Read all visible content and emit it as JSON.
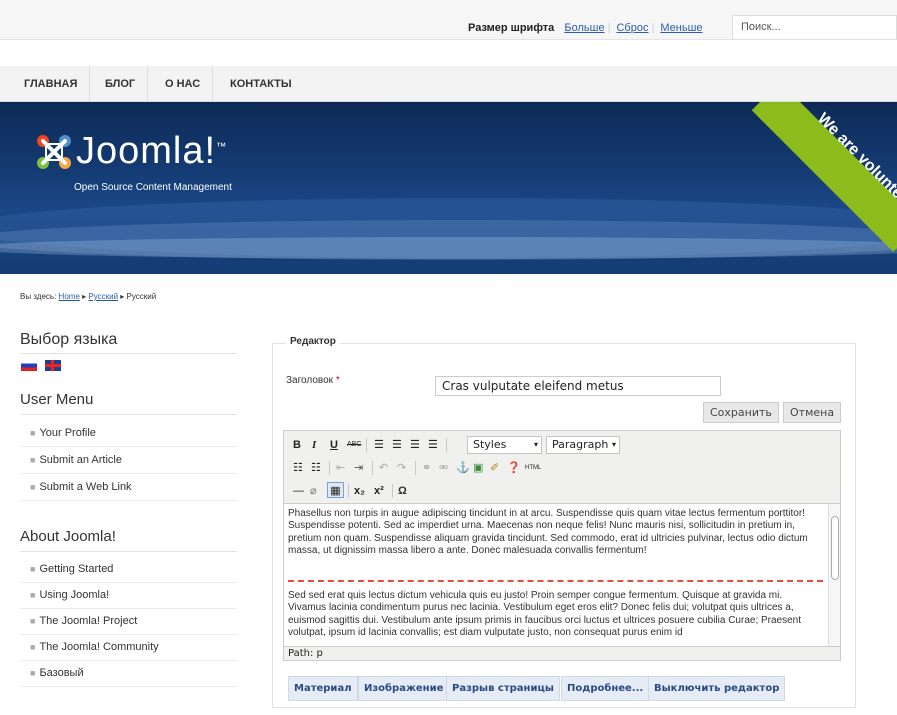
{
  "topbar": {
    "font_size_label": "Размер шрифта",
    "bigger": "Больше",
    "reset": "Сброс",
    "smaller": "Меньше",
    "search_placeholder": "Поиск..."
  },
  "nav": {
    "items": [
      {
        "label": "ГЛАВНАЯ"
      },
      {
        "label": "БЛОГ"
      },
      {
        "label": "О НАС"
      },
      {
        "label": "КОНТАКТЫ"
      }
    ]
  },
  "header": {
    "logo_text": "Joomla!",
    "logo_tm": "™",
    "logo_sub": "Open Source Content Management",
    "ribbon": "We are volunteers!",
    "colors": {
      "accent_ribbon": "#8cbc1c",
      "header_blue": "#13396f"
    }
  },
  "breadcrumb": {
    "prefix": "Вы здесь:",
    "items": [
      "Home",
      "Русский",
      "Русский"
    ]
  },
  "sidebar": {
    "lang_title": "Выбор языка",
    "user_menu_title": "User Menu",
    "user_menu": [
      "Your Profile",
      "Submit an Article",
      "Submit a Web Link"
    ],
    "about_title": "About Joomla!",
    "about": [
      "Getting Started",
      "Using Joomla!",
      "The Joomla! Project",
      "The Joomla! Community",
      "Базовый"
    ]
  },
  "editor": {
    "legend": "Редактор",
    "title_label": "Заголовок",
    "title_required": "*",
    "title_value": "Cras vulputate eleifend metus",
    "save": "Сохранить",
    "cancel": "Отмена",
    "styles_select": "Styles",
    "format_select": "Paragraph",
    "paragraph1": "Phasellus non turpis in augue adipiscing tincidunt in at arcu. Suspendisse quis quam vitae lectus fermentum porttitor! Suspendisse potenti. Sed ac imperdiet urna. Maecenas non neque felis! Nunc mauris nisi, sollicitudin in pretium in, pretium non quam. Suspendisse aliquam gravida tincidunt. Sed commodo, erat id ultricies pulvinar, lectus odio dictum massa, ut dignissim massa libero a ante. Donec malesuada convallis fermentum!",
    "paragraph2": "Sed sed erat quis lectus dictum vehicula quis eu justo! Proin semper congue fermentum. Quisque at gravida mi. Vivamus lacinia condimentum purus nec lacinia. Vestibulum eget eros elit? Donec felis dui; volutpat quis ultrices a, euismod sagittis dui. Vestibulum ante ipsum primis in faucibus orci luctus et ultrices posuere cubilia Curae; Praesent volutpat, ipsum id lacinia convallis; est diam vulputate justo, non consequat purus enim id",
    "path": "Path: p",
    "extra_buttons": [
      "Материал",
      "Изображение",
      "Разрыв страницы",
      "Подробнее...",
      "Выключить редактор"
    ]
  }
}
